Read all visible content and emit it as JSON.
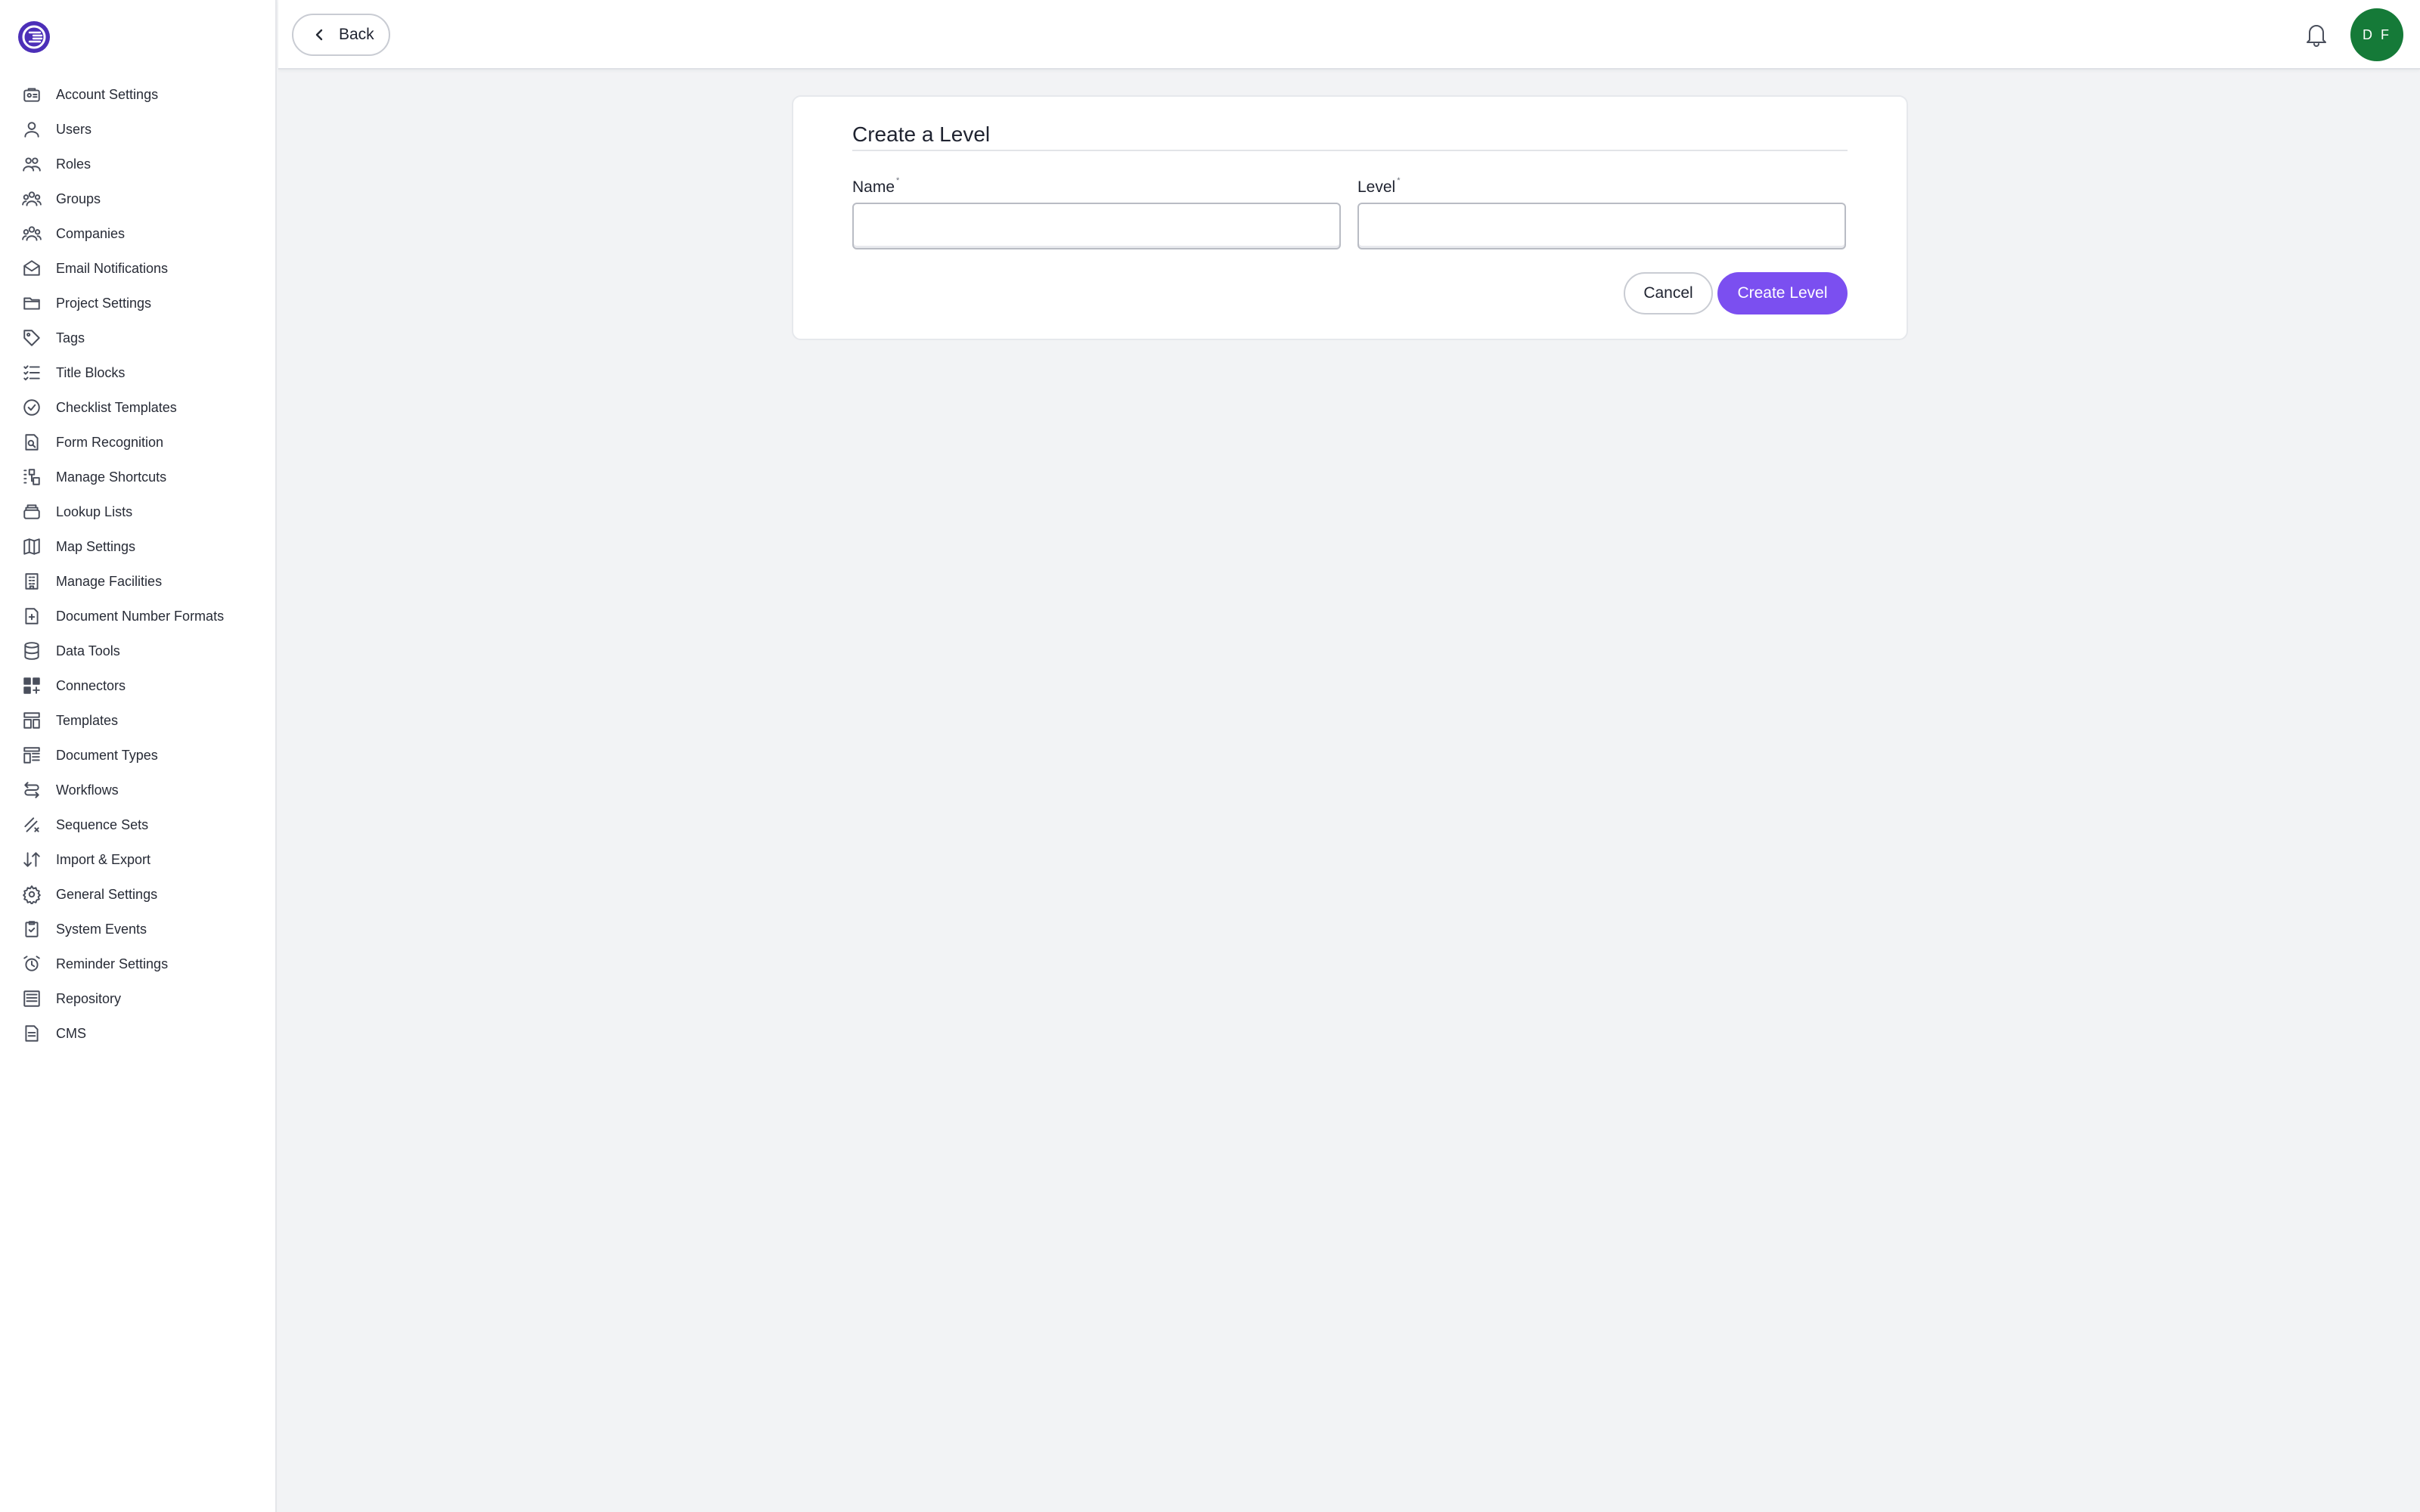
{
  "brand": {
    "logo_icon": "app-logo-icon",
    "accent": "#7b4ff0",
    "logo_color": "#4c2fb8"
  },
  "sidebar": {
    "items": [
      {
        "label": "Account Settings",
        "icon": "account-settings-icon"
      },
      {
        "label": "Users",
        "icon": "user-icon"
      },
      {
        "label": "Roles",
        "icon": "roles-icon"
      },
      {
        "label": "Groups",
        "icon": "groups-icon"
      },
      {
        "label": "Companies",
        "icon": "companies-icon"
      },
      {
        "label": "Email Notifications",
        "icon": "envelope-icon"
      },
      {
        "label": "Project Settings",
        "icon": "folder-icon"
      },
      {
        "label": "Tags",
        "icon": "tag-icon"
      },
      {
        "label": "Title Blocks",
        "icon": "checklist-icon"
      },
      {
        "label": "Checklist Templates",
        "icon": "check-circle-icon"
      },
      {
        "label": "Form Recognition",
        "icon": "form-recognition-icon"
      },
      {
        "label": "Manage Shortcuts",
        "icon": "shortcuts-icon"
      },
      {
        "label": "Lookup Lists",
        "icon": "lookup-icon"
      },
      {
        "label": "Map Settings",
        "icon": "map-icon"
      },
      {
        "label": "Manage Facilities",
        "icon": "building-icon"
      },
      {
        "label": "Document Number Formats",
        "icon": "document-number-icon"
      },
      {
        "label": "Data Tools",
        "icon": "database-icon"
      },
      {
        "label": "Connectors",
        "icon": "connectors-icon"
      },
      {
        "label": "Templates",
        "icon": "templates-icon"
      },
      {
        "label": "Document Types",
        "icon": "document-types-icon"
      },
      {
        "label": "Workflows",
        "icon": "workflow-icon"
      },
      {
        "label": "Sequence Sets",
        "icon": "sequence-icon"
      },
      {
        "label": "Import & Export",
        "icon": "import-export-icon"
      },
      {
        "label": "General Settings",
        "icon": "gear-icon"
      },
      {
        "label": "System Events",
        "icon": "clipboard-check-icon"
      },
      {
        "label": "Reminder Settings",
        "icon": "alarm-icon"
      },
      {
        "label": "Repository",
        "icon": "repository-icon"
      },
      {
        "label": "CMS",
        "icon": "document-icon"
      }
    ]
  },
  "header": {
    "back_label": "Back",
    "avatar_initials": "D F",
    "avatar_color": "#157a38"
  },
  "form": {
    "title": "Create a Level",
    "name_label": "Name",
    "level_label": "Level",
    "required_mark": "*",
    "name_value": "",
    "level_value": "",
    "cancel_label": "Cancel",
    "create_label": "Create Level"
  }
}
